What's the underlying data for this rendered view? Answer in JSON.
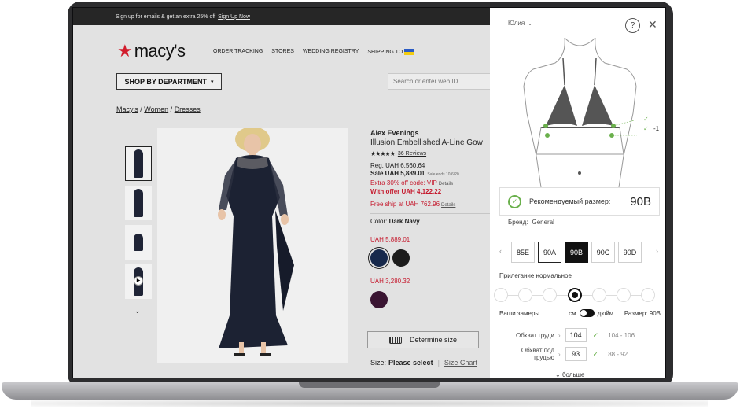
{
  "promo": {
    "text": "Sign up for emails & get an extra 25% off",
    "link": "Sign Up Now"
  },
  "logo": {
    "star": "★",
    "word": "macy's"
  },
  "nav": [
    "ORDER TRACKING",
    "STORES",
    "WEDDING REGISTRY",
    "SHIPPING TO"
  ],
  "shop": {
    "label": "SHOP BY DEPARTMENT",
    "caret": "▾"
  },
  "search": {
    "placeholder": "Search or enter web ID"
  },
  "breadcrumb": {
    "a": "Macy's",
    "b": "Women",
    "c": "Dresses",
    "sep": "/"
  },
  "product": {
    "brand": "Alex Evenings",
    "name": "Illusion Embellished A-Line Gow",
    "stars": "★★★★★",
    "reviews": "36 Reviews",
    "reg": "Reg. UAH 6,560.64",
    "sale": "Sale UAH 5,889.01",
    "sale_ends": "Sale ends 10/6/20",
    "extra": "Extra 30% off code: VIP",
    "details": "Details",
    "with_offer": "With offer UAH 4,122.22",
    "free_ship": "Free ship at UAH 762.96",
    "color_prefix": "Color:",
    "color_value": "Dark Navy",
    "price_a": "UAH 5,889.01",
    "price_b": "UAH 3,280.32",
    "thumb_down": "⌄",
    "determine": "Determine size",
    "size_prefix": "Size:",
    "size_value": "Please select",
    "size_sep": "|",
    "size_chart": "Size Chart"
  },
  "colors": {
    "navy": "#17294c",
    "black": "#1c1c1c",
    "plum": "#3a1532",
    "accent_red": "#c5192d",
    "check_green": "#6ab04c"
  },
  "icons": {
    "help": "?",
    "close": "✕",
    "check": "✓",
    "left": "‹",
    "right": "›",
    "play": "▶",
    "caret_down": "⌄"
  },
  "panel": {
    "user": "Юлия",
    "fit_delta": "-1",
    "rec_label": "Рекомендуемый размер:",
    "rec_size": "90B",
    "brand_label": "Бренд:",
    "brand_value": "General",
    "sizes": [
      "85E",
      "90A",
      "90B",
      "90C",
      "90D"
    ],
    "recommended_index": 1,
    "selected_index": 2,
    "fit_label": "Прилегание нормальное",
    "fit_steps": 7,
    "fit_selected_step": 4,
    "measure_label": "Ваши замеры",
    "unit_cm": "см",
    "unit_in": "дюйм",
    "size_text": "Размер: 90B",
    "measurements": [
      {
        "label": "Обхват груди",
        "value": "104",
        "range": "104 - 106"
      },
      {
        "label": "Обхват под грудью",
        "value": "93",
        "range": "88 - 92"
      }
    ],
    "more": "больше"
  }
}
